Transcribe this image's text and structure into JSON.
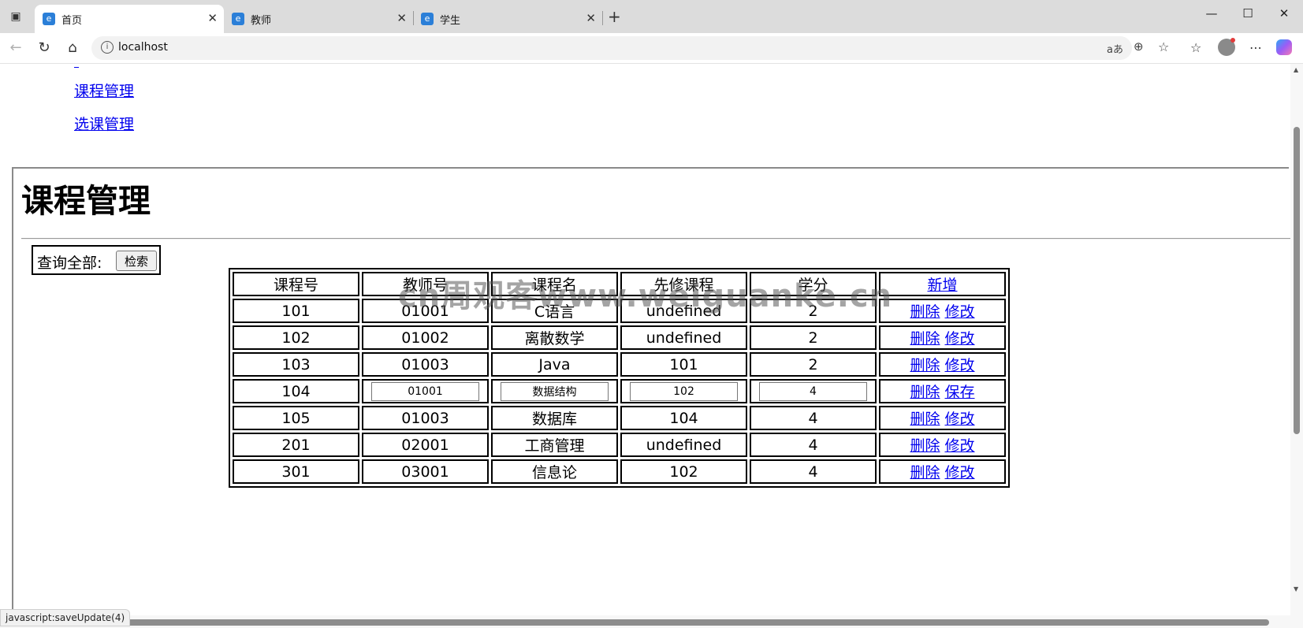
{
  "browser": {
    "tabs": [
      {
        "title": "首页",
        "active": true
      },
      {
        "title": "教师",
        "active": false
      },
      {
        "title": "学生",
        "active": false
      }
    ],
    "url": "localhost",
    "status_text": "javascript:saveUpdate(4)"
  },
  "nav_links": [
    "课程管理",
    "选课管理"
  ],
  "page": {
    "title": "课程管理",
    "query_label": "查询全部:",
    "search_button": "检索"
  },
  "table": {
    "headers": [
      "课程号",
      "教师号",
      "课程名",
      "先修课程",
      "学分",
      "新增"
    ],
    "rows": [
      {
        "id": "101",
        "teacher": "01001",
        "name": "C语言",
        "prereq": "undefined",
        "credit": "2",
        "editing": false,
        "action1": "删除",
        "action2": "修改"
      },
      {
        "id": "102",
        "teacher": "01002",
        "name": "离散数学",
        "prereq": "undefined",
        "credit": "2",
        "editing": false,
        "action1": "删除",
        "action2": "修改"
      },
      {
        "id": "103",
        "teacher": "01003",
        "name": "Java",
        "prereq": "101",
        "credit": "2",
        "editing": false,
        "action1": "删除",
        "action2": "修改"
      },
      {
        "id": "104",
        "teacher": "01001",
        "name": "数据结构",
        "prereq": "102",
        "credit": "4",
        "editing": true,
        "action1": "删除",
        "action2": "保存"
      },
      {
        "id": "105",
        "teacher": "01003",
        "name": "数据库",
        "prereq": "104",
        "credit": "4",
        "editing": false,
        "action1": "删除",
        "action2": "修改"
      },
      {
        "id": "201",
        "teacher": "02001",
        "name": "工商管理",
        "prereq": "undefined",
        "credit": "4",
        "editing": false,
        "action1": "删除",
        "action2": "修改"
      },
      {
        "id": "301",
        "teacher": "03001",
        "name": "信息论",
        "prereq": "102",
        "credit": "4",
        "editing": false,
        "action1": "删除",
        "action2": "修改"
      }
    ]
  },
  "watermark": "cn周观客www.weiguanke.cn"
}
